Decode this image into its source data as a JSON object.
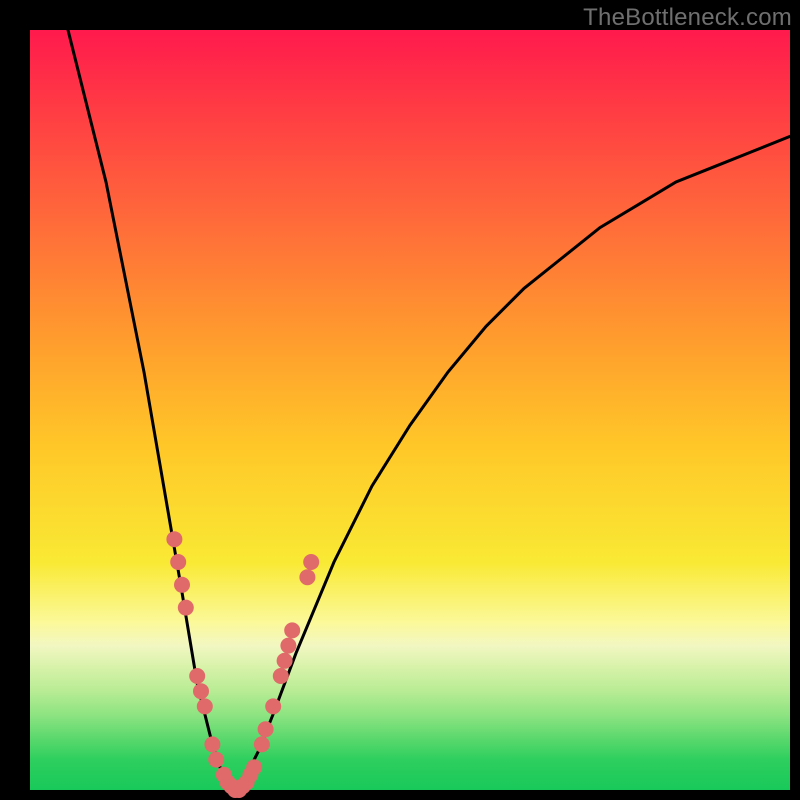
{
  "watermark": "TheBottleneck.com",
  "colors": {
    "frame": "#000000",
    "curve": "#000000",
    "dots": "#e06a6a",
    "watermark_text": "#6f6f6f"
  },
  "chart_data": {
    "type": "line",
    "title": "",
    "xlabel": "",
    "ylabel": "",
    "xlim": [
      0,
      100
    ],
    "ylim": [
      0,
      100
    ],
    "grid": false,
    "legend": false,
    "series": [
      {
        "name": "bottleneck-curve",
        "description": "V-shaped bottleneck curve; y≈0 at optimum around x≈27, rising steeply on both sides",
        "x": [
          5,
          10,
          15,
          20,
          22,
          24,
          25,
          26,
          27,
          28,
          29,
          30,
          32,
          35,
          40,
          45,
          50,
          55,
          60,
          65,
          70,
          75,
          80,
          85,
          90,
          95,
          100
        ],
        "values": [
          100,
          80,
          55,
          26,
          14,
          6,
          3,
          1,
          0,
          1,
          3,
          5,
          10,
          18,
          30,
          40,
          48,
          55,
          61,
          66,
          70,
          74,
          77,
          80,
          82,
          84,
          86
        ]
      }
    ],
    "scatter_points": {
      "name": "sample-dots",
      "description": "Salmon dots clustered along lower arms of the V near the minimum",
      "points": [
        {
          "x": 19,
          "y": 33
        },
        {
          "x": 19.5,
          "y": 30
        },
        {
          "x": 20,
          "y": 27
        },
        {
          "x": 20.5,
          "y": 24
        },
        {
          "x": 22,
          "y": 15
        },
        {
          "x": 22.5,
          "y": 13
        },
        {
          "x": 23,
          "y": 11
        },
        {
          "x": 24,
          "y": 6
        },
        {
          "x": 24.5,
          "y": 4
        },
        {
          "x": 25.5,
          "y": 2
        },
        {
          "x": 26,
          "y": 1
        },
        {
          "x": 26.5,
          "y": 0.5
        },
        {
          "x": 27,
          "y": 0
        },
        {
          "x": 27.5,
          "y": 0
        },
        {
          "x": 28,
          "y": 0.5
        },
        {
          "x": 28.5,
          "y": 1
        },
        {
          "x": 29,
          "y": 2
        },
        {
          "x": 29.5,
          "y": 3
        },
        {
          "x": 30.5,
          "y": 6
        },
        {
          "x": 31,
          "y": 8
        },
        {
          "x": 32,
          "y": 11
        },
        {
          "x": 33,
          "y": 15
        },
        {
          "x": 33.5,
          "y": 17
        },
        {
          "x": 34,
          "y": 19
        },
        {
          "x": 34.5,
          "y": 21
        },
        {
          "x": 36.5,
          "y": 28
        },
        {
          "x": 37,
          "y": 30
        }
      ]
    }
  }
}
